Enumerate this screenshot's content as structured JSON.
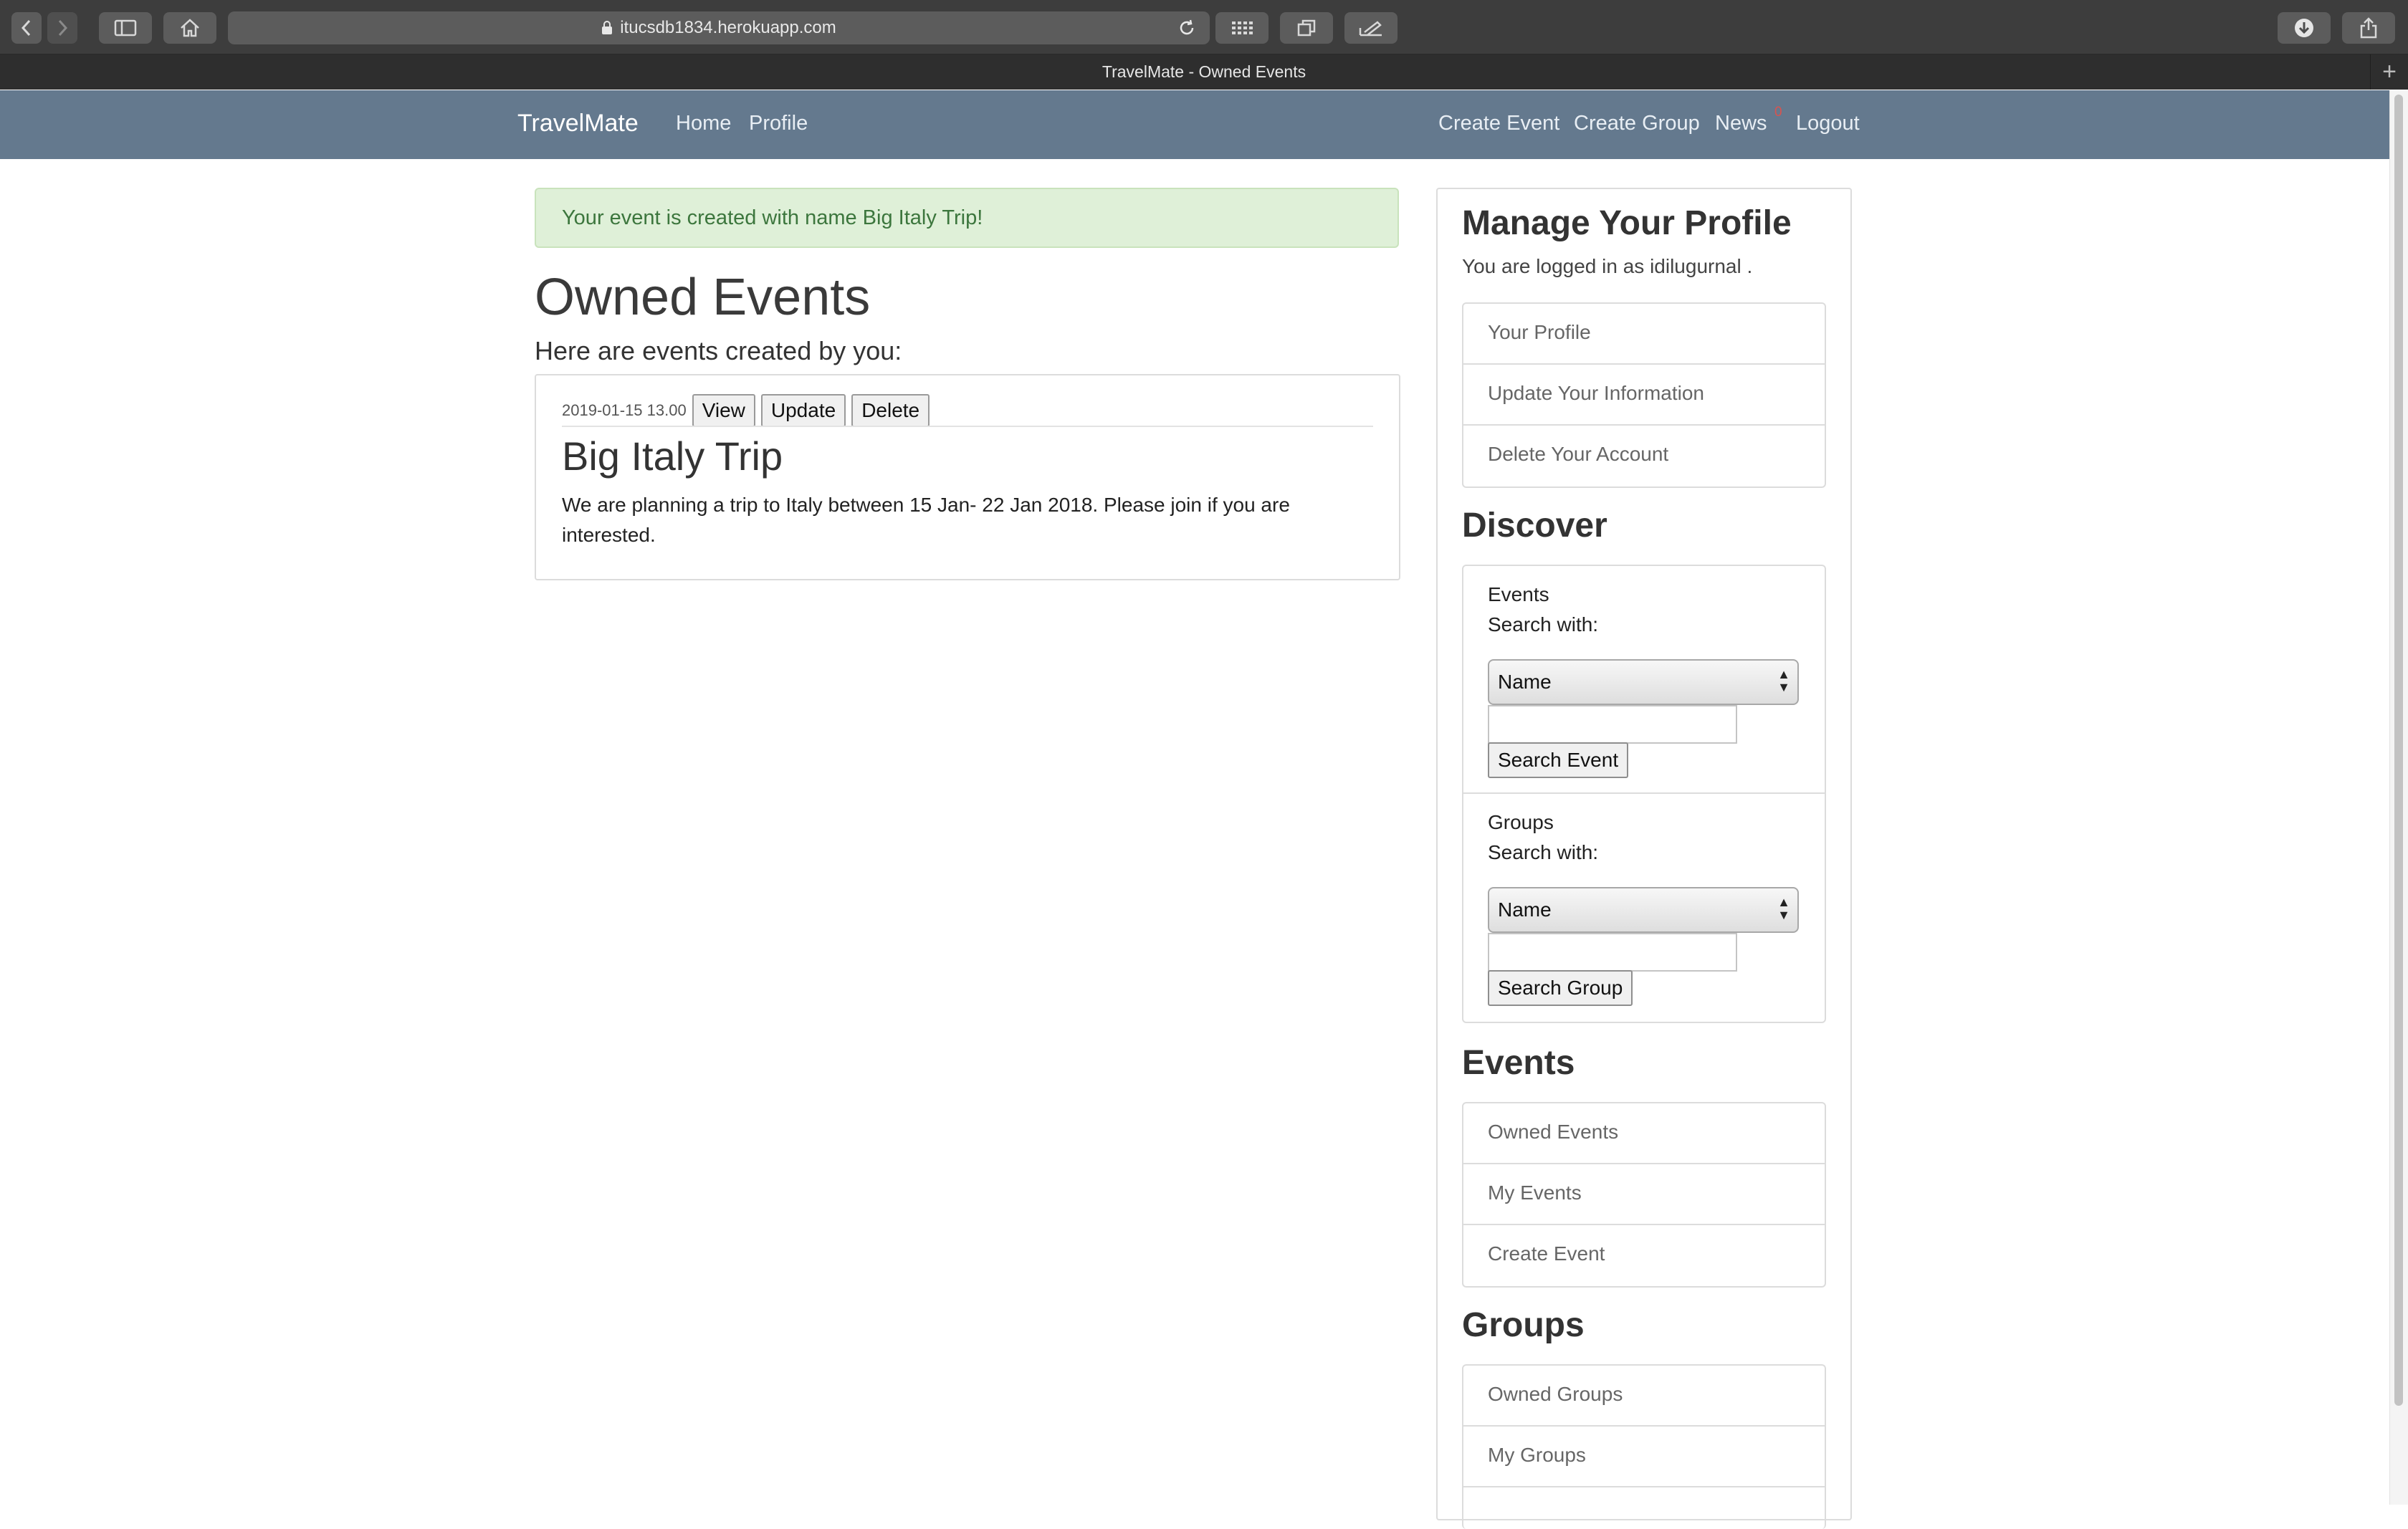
{
  "browser": {
    "url": "itucsdb1834.herokuapp.com",
    "tab_title": "TravelMate - Owned Events"
  },
  "navbar": {
    "brand": "TravelMate",
    "left_links": [
      "Home",
      "Profile"
    ],
    "right_links": [
      "Create Event",
      "Create Group",
      "News",
      "Logout"
    ],
    "news_badge": "0"
  },
  "alert": {
    "text": "Your event is created with name Big Italy Trip!"
  },
  "main": {
    "title": "Owned Events",
    "subtitle": "Here are events created by you:",
    "events": [
      {
        "date": "2019-01-15 13.00",
        "buttons": [
          "View",
          "Update",
          "Delete"
        ],
        "title": "Big Italy Trip",
        "description": "We are planning a trip to Italy between 15 Jan- 22 Jan 2018. Please join if you are interested."
      }
    ]
  },
  "sidebar": {
    "profile_heading": "Manage Your Profile",
    "logged_in_text": "You are logged in as idilugurnal .",
    "profile_links": [
      "Your Profile",
      "Update Your Information",
      "Delete Your Account"
    ],
    "discover_heading": "Discover",
    "events_search": {
      "label": "Events",
      "search_with": "Search with:",
      "selected": "Name",
      "button": "Search Event"
    },
    "groups_search": {
      "label": "Groups",
      "search_with": "Search with:",
      "selected": "Name",
      "button": "Search Group"
    },
    "events_heading": "Events",
    "events_links": [
      "Owned Events",
      "My Events",
      "Create Event"
    ],
    "groups_heading": "Groups",
    "groups_links": [
      "Owned Groups",
      "My Groups"
    ]
  }
}
